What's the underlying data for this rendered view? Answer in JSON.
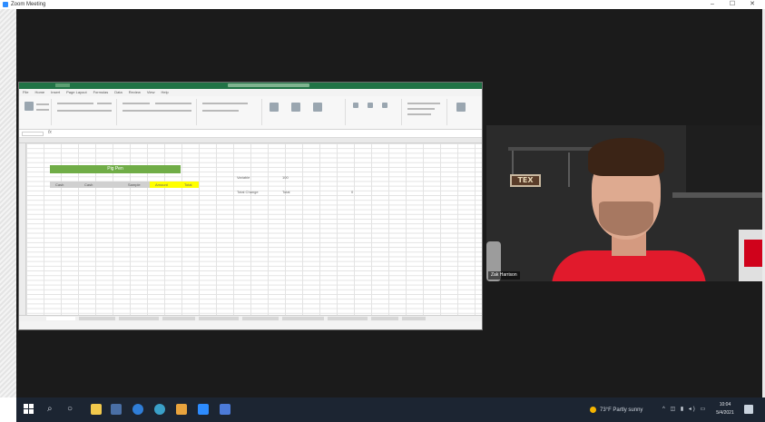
{
  "window": {
    "title": "Zoom Meeting",
    "minimize": "–",
    "maximize": "☐",
    "close": "✕"
  },
  "excel": {
    "menu_tabs": [
      "File",
      "Home",
      "Insert",
      "Page Layout",
      "Formulas",
      "Data",
      "Review",
      "View",
      "Help"
    ],
    "header_cell": "Pig Pen",
    "row2_cells": [
      "Cash",
      "Cash",
      "Sample"
    ],
    "yellow_cells": [
      "Amount",
      "Total"
    ],
    "side_labels": [
      "Variable",
      "Total Change",
      "Total"
    ],
    "side_values": [
      "100",
      "0",
      "0"
    ],
    "sheet_tabs": [
      "Sheet1",
      "Sheet2",
      "Sheet3",
      "Sheet4",
      "Sheet5",
      "Sheet6",
      "Sheet7",
      "Sheet8",
      "Sheet9",
      "Sheet10"
    ]
  },
  "video": {
    "sign_text": "TEX",
    "participant_name": "Zak Harrison"
  },
  "taskbar": {
    "weather": "73°F Partly sunny",
    "time": "10:04",
    "date": "5/4/2021",
    "icons": [
      "start-icon",
      "search-icon",
      "task-view-icon",
      "file-explorer-icon",
      "store-icon",
      "edge-icon",
      "chrome-icon",
      "folder-icon",
      "zoom-icon",
      "excel-icon"
    ]
  },
  "colors": {
    "excel_green": "#217346",
    "header_green": "#70ad47",
    "highlight_yellow": "#ffff00",
    "shirt_red": "#e11a2c",
    "taskbar": "#1c2532"
  }
}
